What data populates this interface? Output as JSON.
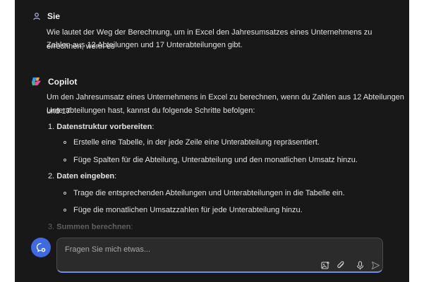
{
  "user_message": {
    "author": "Sie",
    "lines": [
      "Wie lautet der Weg der Berechnung, um in Excel den Jahresumsatzes eines Unternehmens zu errechnen, wenn es",
      "Zahlen aus 12 Abteilungen und 17 Unterabteilungen gibt."
    ]
  },
  "copilot_message": {
    "author": "Copilot",
    "intro_lines": [
      "Um den Jahresumsatz eines Unternehmens in Excel zu berechnen, wenn du Zahlen aus 12 Abteilungen und 17",
      "Unterabteilungen hast, kannst du folgende Schritte befolgen:"
    ],
    "steps": [
      {
        "number": "1.",
        "title": "Datenstruktur vorbereiten",
        "suffix": ":",
        "bullets": [
          "Erstelle eine Tabelle, in der jede Zeile eine Unterabteilung repräsentiert.",
          "Füge Spalten für die Abteilung, Unterabteilung und den monatlichen Umsatz hinzu."
        ]
      },
      {
        "number": "2.",
        "title": "Daten eingeben",
        "suffix": ":",
        "bullets": [
          "Trage die entsprechenden Abteilungen und Unterabteilungen in die Tabelle ein.",
          "Füge die monatlichen Umsatzzahlen für jede Unterabteilung hinzu."
        ]
      },
      {
        "number": "3.",
        "title": "Summen berechnen",
        "suffix": ":"
      }
    ]
  },
  "composer": {
    "placeholder": "Fragen Sie mich etwas..."
  },
  "colors": {
    "background": "#181818",
    "accent": "#3f6ae2",
    "composer_bg": "#2b2b2b"
  },
  "icons": {
    "user_avatar": "person-icon",
    "copilot_logo": "copilot-logo-icon",
    "new_chat": "new-chat-icon",
    "image_upload": "image-upload-icon",
    "attach": "paperclip-icon",
    "mic": "microphone-icon",
    "send": "send-icon"
  }
}
